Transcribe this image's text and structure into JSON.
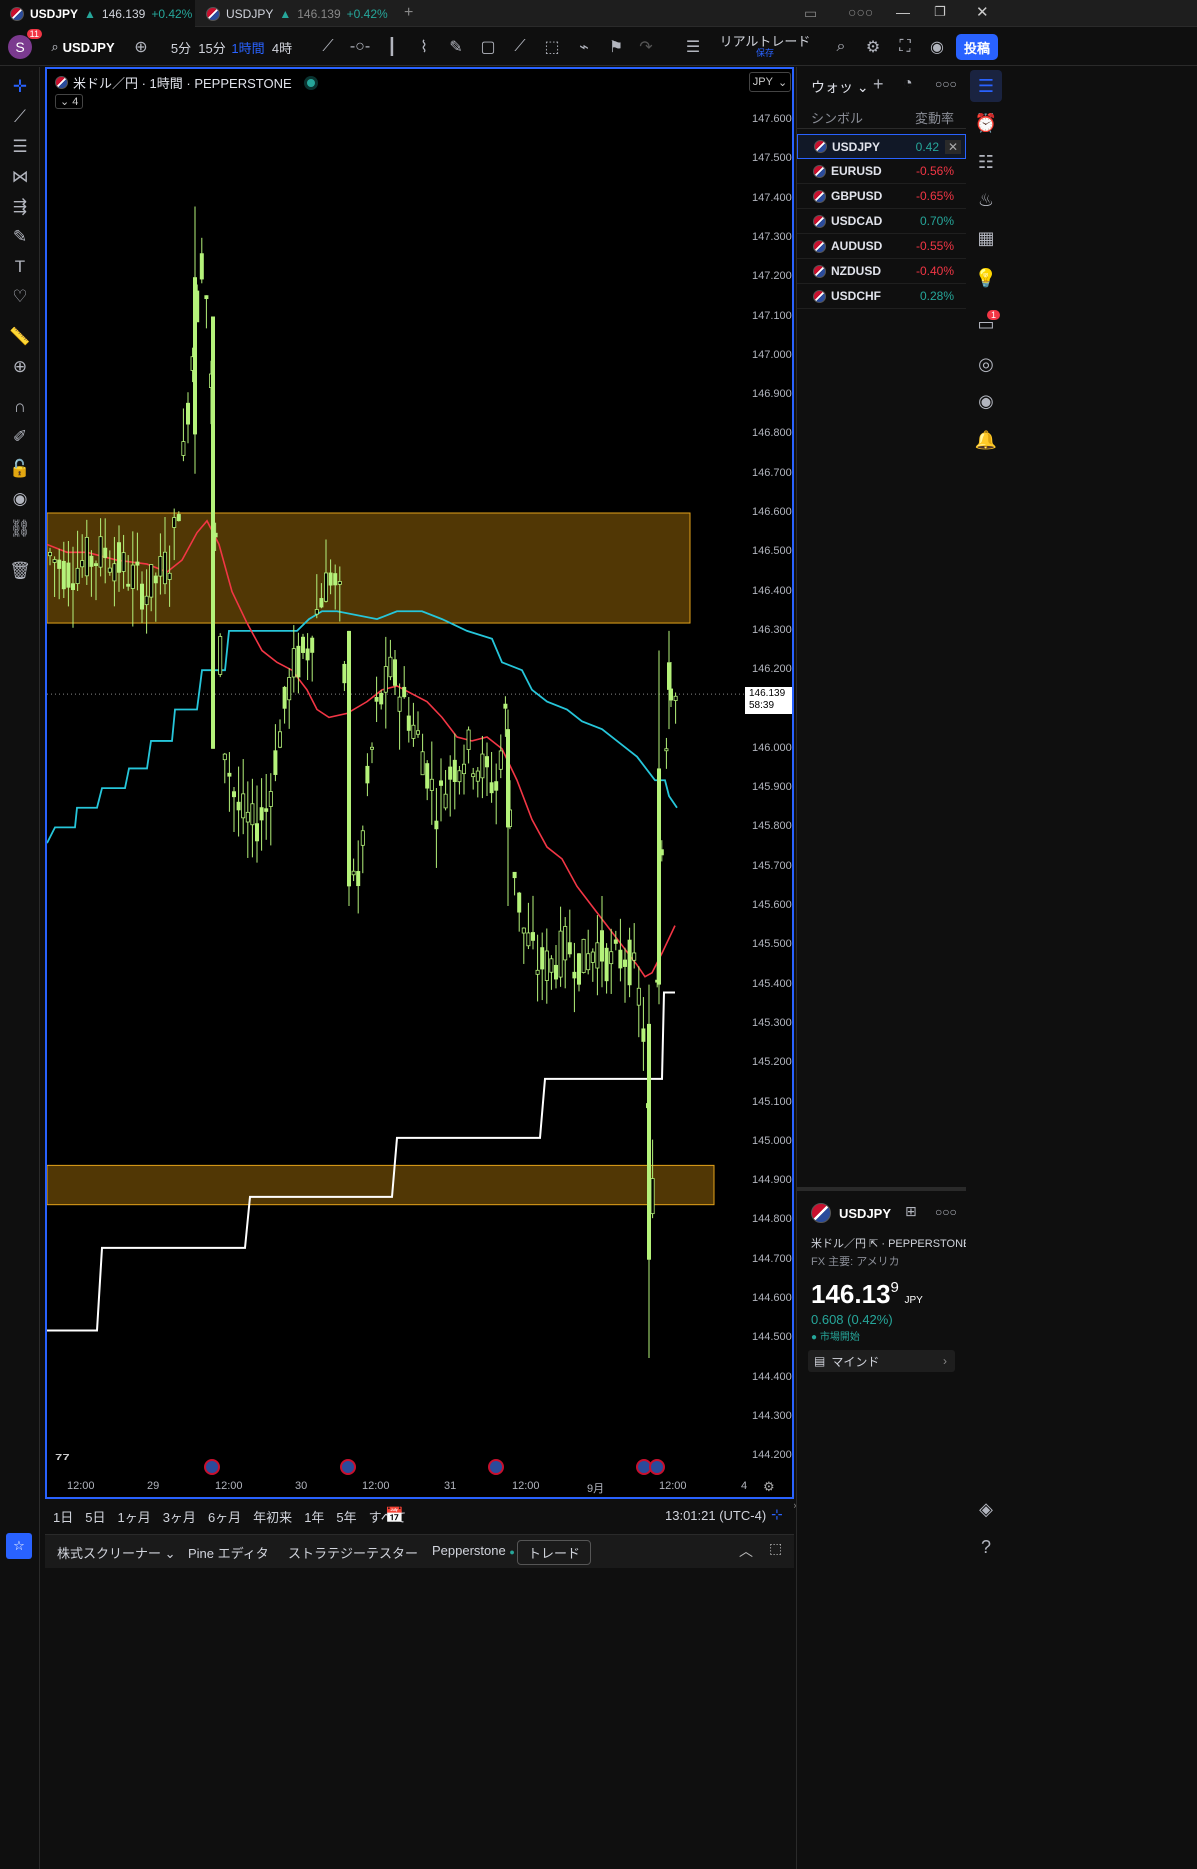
{
  "tabs": [
    {
      "symbol": "USDJPY",
      "price": "146.139",
      "change": "+0.42%",
      "active": true
    },
    {
      "symbol": "USDJPY",
      "price": "146.139",
      "change": "+0.42%",
      "active": false
    }
  ],
  "toolbar": {
    "symbol": "USDJPY",
    "avatar_letter": "S",
    "avatar_badge": "11",
    "intervals": [
      "5分",
      "15分",
      "1時間",
      "4時"
    ],
    "active_interval": "1時間",
    "trade_label": "リアルトレード",
    "trade_sub": "保存",
    "post_button": "投稿"
  },
  "chart": {
    "title": "米ドル／円 · 1時間 · PEPPERSTONE",
    "collapse_label": "4",
    "currency": "JPY",
    "current_price": "146.139",
    "countdown": "58:39",
    "price_ticks": [
      "147.600",
      "147.500",
      "147.400",
      "147.300",
      "147.200",
      "147.100",
      "147.000",
      "146.900",
      "146.800",
      "146.700",
      "146.600",
      "146.500",
      "146.400",
      "146.300",
      "146.200",
      "146.100",
      "146.000",
      "145.900",
      "145.800",
      "145.700",
      "145.600",
      "145.500",
      "145.400",
      "145.300",
      "145.200",
      "145.100",
      "145.000",
      "144.900",
      "144.800",
      "144.700",
      "144.600",
      "144.500",
      "144.400",
      "144.300",
      "144.200"
    ],
    "time_labels": [
      "12:00",
      "29",
      "12:00",
      "30",
      "12:00",
      "31",
      "12:00",
      "9月",
      "12:00",
      "4"
    ],
    "colors": {
      "candle": "#b5f27a",
      "zone": "#e3a21a",
      "ma_red": "#f23645",
      "ma_cyan": "#26c6da",
      "step_white": "#ffffff"
    }
  },
  "chart_data": {
    "type": "candlestick",
    "ylim": [
      144.15,
      147.65
    ],
    "zones": [
      {
        "low": 146.32,
        "high": 146.6
      },
      {
        "low": 144.84,
        "high": 144.94
      }
    ]
  },
  "bottombar": {
    "ranges": [
      "1日",
      "5日",
      "1ヶ月",
      "3ヶ月",
      "6ヶ月",
      "年初来",
      "1年",
      "5年",
      "すべて"
    ],
    "clock": "13:01:21 (UTC-4)"
  },
  "footer": {
    "tabs": [
      "株式スクリーナー",
      "Pine エディタ",
      "ストラテジーテスター",
      "Pepperstone",
      "トレード"
    ]
  },
  "watchlist": {
    "title": "ウォッ",
    "col_symbol": "シンボル",
    "col_change": "変動率",
    "rows": [
      {
        "symbol": "USDJPY",
        "change": "0.42",
        "dir": "up",
        "selected": true
      },
      {
        "symbol": "EURUSD",
        "change": "-0.56%",
        "dir": "dn"
      },
      {
        "symbol": "GBPUSD",
        "change": "-0.65%",
        "dir": "dn"
      },
      {
        "symbol": "USDCAD",
        "change": "0.70%",
        "dir": "up"
      },
      {
        "symbol": "AUDUSD",
        "change": "-0.55%",
        "dir": "dn"
      },
      {
        "symbol": "NZDUSD",
        "change": "-0.40%",
        "dir": "dn"
      },
      {
        "symbol": "USDCHF",
        "change": "0.28%",
        "dir": "up"
      }
    ]
  },
  "details": {
    "symbol": "USDJPY",
    "name": "米ドル／円",
    "broker": "PEPPERSTONE",
    "category": "FX 主要: アメリカ",
    "price_main": "146.13",
    "price_last": "9",
    "currency": "JPY",
    "change": "0.608 (0.42%)",
    "market_status": "市場開始",
    "mind_label": "マインド"
  },
  "notif_badge": "1"
}
